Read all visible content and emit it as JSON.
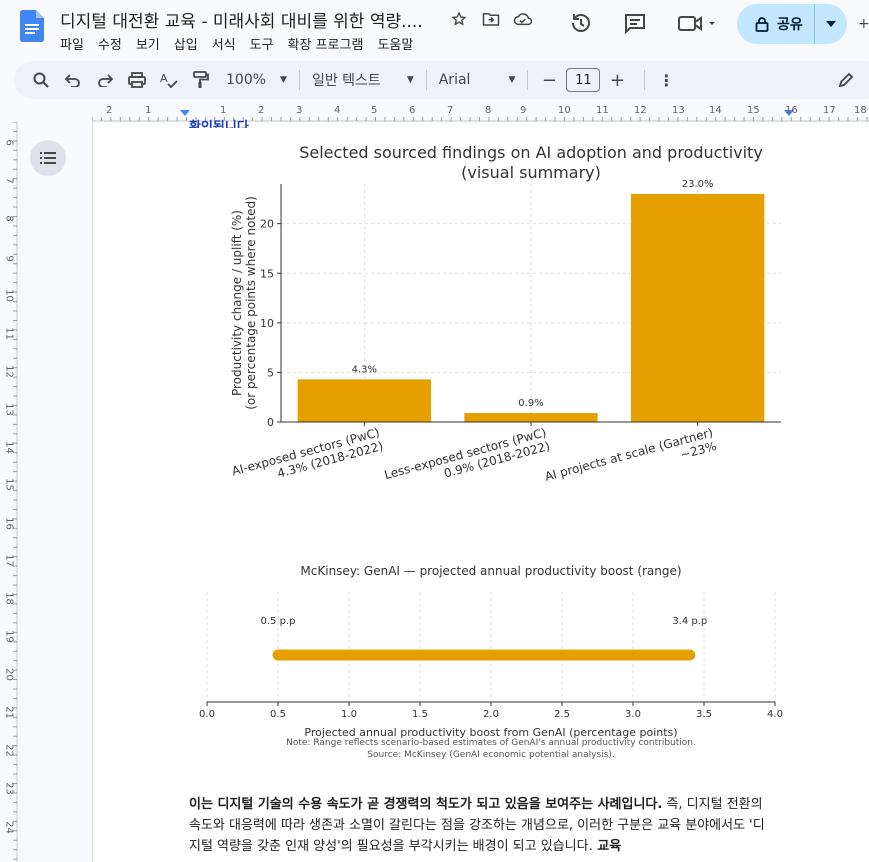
{
  "window": {
    "title": "디지털 대전환 교육 - 미래사회 대비를 위한 역량....",
    "menu": [
      "파일",
      "수정",
      "보기",
      "삽입",
      "서식",
      "도구",
      "확장 프로그램",
      "도움말"
    ],
    "share_label": "공유"
  },
  "icons": {
    "doc": "docs-logo-icon",
    "star": "star-icon",
    "move": "move-to-folder-icon",
    "cloud": "cloud-status-icon",
    "history": "history-icon",
    "comment": "comment-icon",
    "meet": "video-call-icon",
    "lock": "lock-icon"
  },
  "toolbar": {
    "zoom": "100%",
    "style": "일반 텍스트",
    "font": "Arial",
    "font_size": "11"
  },
  "ruler": {
    "h": [
      "2",
      "1",
      "1",
      "2",
      "3",
      "4",
      "5",
      "6",
      "7",
      "8",
      "9",
      "10",
      "11",
      "12",
      "13",
      "14",
      "15",
      "16",
      "17",
      "18"
    ],
    "v": [
      "6",
      "7",
      "8",
      "9",
      "10",
      "11",
      "12",
      "13",
      "14",
      "15",
      "16",
      "17",
      "18",
      "19",
      "20",
      "21",
      "22",
      "23",
      "24"
    ]
  },
  "document": {
    "cut_line": "확인됩니다.",
    "paragraph_bold_1": "이는 디지털 기술의 수용 속도가 곧 경쟁력의 척도가 되고 있음을 보여주는 사례입니다.",
    "paragraph_text": " 즉, 디지털 전환의 속도와 대응력에 따라 생존과 소멸이 갈린다는 점을 강조하는 개념으로, 이러한 구분은 교육 분야에서도 '디지털 역량을 갖춘 인재 양성'의 필요성을 부각시키는 배경이 되고 있습니다.",
    "paragraph_bold_2": " 교육"
  },
  "chart_data": [
    {
      "type": "bar",
      "title": "Selected sourced findings on AI adoption and productivity",
      "subtitle": "(visual summary)",
      "ylabel": "Productivity change / uplift (%)",
      "ylabel2": "(or percentage points where noted)",
      "categories": [
        [
          "AI-exposed sectors (PwC)",
          "4.3% (2018-2022)"
        ],
        [
          "Less-exposed sectors (PwC)",
          "0.9% (2018-2022)"
        ],
        [
          "AI projects at scale (Gartner)",
          "~23%"
        ]
      ],
      "values": [
        4.3,
        0.9,
        23.0
      ],
      "value_labels": [
        "4.3%",
        "0.9%",
        "23.0%"
      ],
      "ylim": [
        0,
        24
      ],
      "yticks": [
        0,
        5,
        10,
        15,
        20
      ],
      "color": "#e5a000",
      "grid": true
    },
    {
      "type": "range",
      "title": "McKinsey: GenAI — projected annual productivity boost (range)",
      "xlabel": "Projected annual productivity boost from GenAI (percentage points)",
      "range": [
        0.5,
        3.4
      ],
      "range_labels": [
        "0.5 p.p",
        "3.4 p.p"
      ],
      "xlim": [
        0.0,
        4.0
      ],
      "xticks": [
        "0.0",
        "0.5",
        "1.0",
        "1.5",
        "2.0",
        "2.5",
        "3.0",
        "3.5",
        "4.0"
      ],
      "note": "Note: Range reflects scenario-based estimates of GenAI's annual productivity contribution.",
      "source": "Source: McKinsey (GenAI economic potential analysis).",
      "color": "#e5a000",
      "grid": true
    }
  ]
}
